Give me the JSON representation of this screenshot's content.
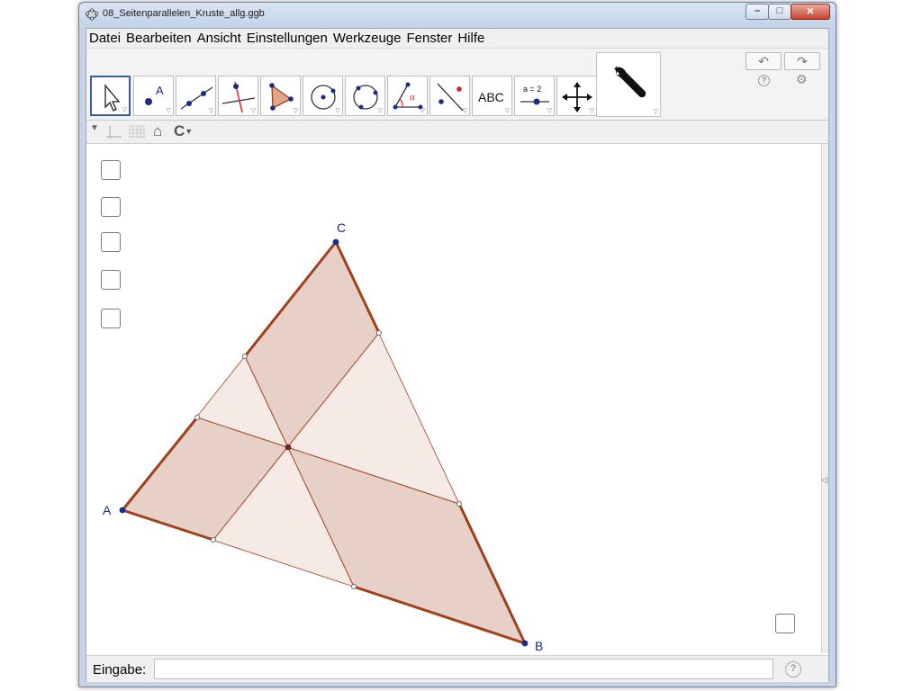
{
  "window": {
    "title": "08_Seitenparallelen_Kruste_allg.ggb",
    "minimize_glyph": "–",
    "maximize_glyph": "□",
    "close_glyph": "✕"
  },
  "menu": [
    "Datei",
    "Bearbeiten",
    "Ansicht",
    "Einstellungen",
    "Werkzeuge",
    "Fenster",
    "Hilfe"
  ],
  "toolbar": {
    "tools": [
      "move",
      "point",
      "line",
      "perpendicular-line",
      "polygon",
      "circle-center",
      "circle-three-points",
      "angle",
      "reflect",
      "text",
      "slider",
      "move-graphics-view"
    ],
    "tool_labels": {
      "point": "A",
      "text": "ABC",
      "slider": "a = 2",
      "angle": "α"
    },
    "customize": "wrench",
    "undo_glyph": "↶",
    "redo_glyph": "↷",
    "help_glyph": "?",
    "settings_glyph": "⚙"
  },
  "stylebar": {
    "toggle": "▼",
    "home": "⌂",
    "cycle": "C"
  },
  "graphics": {
    "labels": {
      "A": "A",
      "B": "B",
      "C": "C"
    },
    "colors": {
      "edge": "#a0401c",
      "fill_dark": "#e6cdc4",
      "fill_light": "#f3e6e0",
      "inner_line": "#a0401c",
      "point": "#1a2c8a",
      "center_point": "#8b1a1a",
      "label": "#1a2c8a"
    }
  },
  "checkboxes": {
    "count_left": 5,
    "count_bottom_right": 1
  },
  "input": {
    "label": "Eingabe:",
    "value": "",
    "help": "?"
  }
}
